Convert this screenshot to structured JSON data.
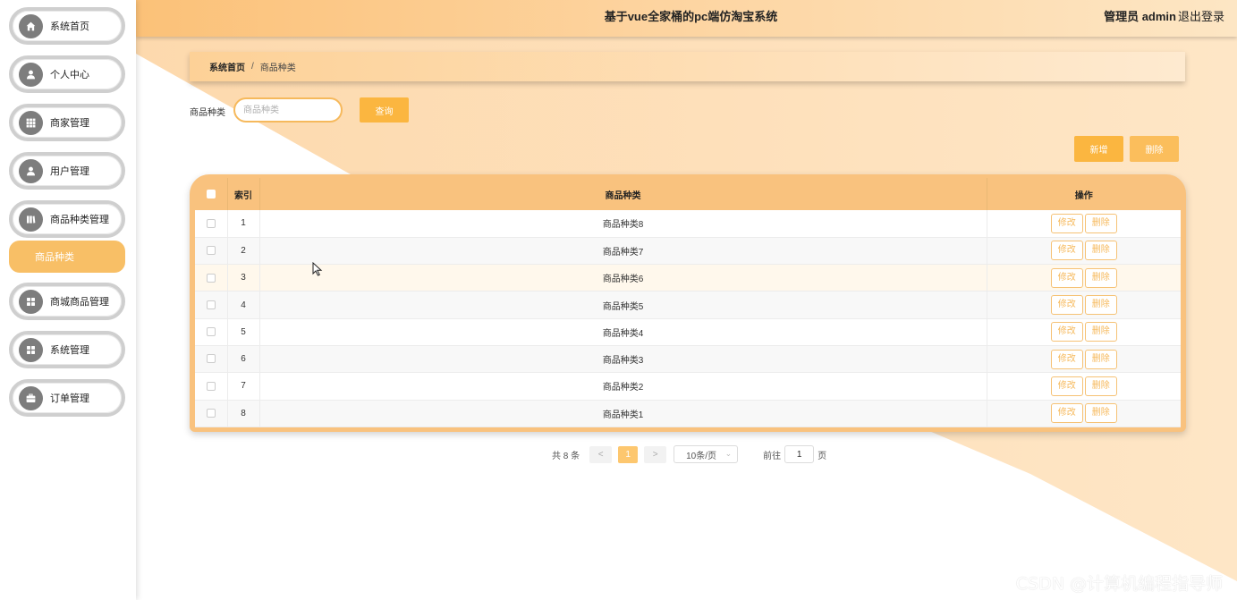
{
  "app": {
    "title": "基于vue全家桶的pc端仿淘宝系统",
    "user_label": "管理员 admin",
    "logout_label": "退出登录"
  },
  "sidebar": {
    "items": [
      {
        "label": "系统首页",
        "icon": "home-icon"
      },
      {
        "label": "个人中心",
        "icon": "user-icon"
      },
      {
        "label": "商家管理",
        "icon": "grid-icon"
      },
      {
        "label": "用户管理",
        "icon": "user-icon"
      },
      {
        "label": "商品种类管理",
        "icon": "book-icon"
      },
      {
        "label": "商城商品管理",
        "icon": "apps-icon"
      },
      {
        "label": "系统管理",
        "icon": "apps-icon"
      },
      {
        "label": "订单管理",
        "icon": "briefcase-icon"
      }
    ],
    "active_subitem": "商品种类"
  },
  "breadcrumb": {
    "home": "系统首页",
    "separator": "/",
    "current": "商品种类"
  },
  "search": {
    "label": "商品种类",
    "placeholder": "商品种类",
    "query_label": "查询"
  },
  "toolbar": {
    "add_label": "新增",
    "delete_label": "删除"
  },
  "table": {
    "columns": [
      "索引",
      "商品种类",
      "操作"
    ],
    "rows": [
      {
        "index": "1",
        "category": "商品种类8"
      },
      {
        "index": "2",
        "category": "商品种类7"
      },
      {
        "index": "3",
        "category": "商品种类6"
      },
      {
        "index": "4",
        "category": "商品种类5"
      },
      {
        "index": "5",
        "category": "商品种类4"
      },
      {
        "index": "6",
        "category": "商品种类3"
      },
      {
        "index": "7",
        "category": "商品种类2"
      },
      {
        "index": "8",
        "category": "商品种类1"
      }
    ],
    "edit_label": "修改",
    "delete_label": "删除"
  },
  "pagination": {
    "total_text": "共 8 条",
    "prev": "<",
    "next": ">",
    "current_page": "1",
    "page_size": "10条/页",
    "goto_label": "前往",
    "goto_value": "1",
    "page_suffix": "页"
  },
  "watermark": "CSDN @计算机编程指导师",
  "colors": {
    "accent": "#fbb640",
    "header_gradient_start": "#fbc178",
    "header_gradient_end": "#fde6c4",
    "active_menu": "#f8bf66",
    "sidebar_border": "#cfcfcf"
  }
}
